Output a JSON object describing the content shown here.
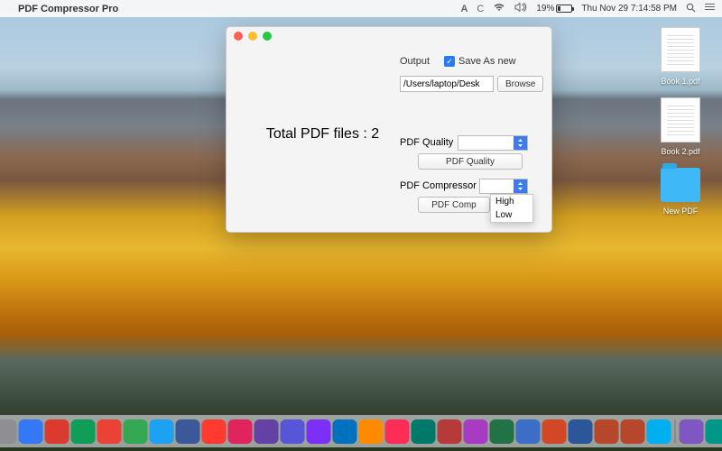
{
  "menubar": {
    "app_name": "PDF Compressor Pro",
    "adobe": "A",
    "battery_pct": "19%",
    "datetime": "Thu Nov 29  7:14:58 PM"
  },
  "desktop": {
    "book1": "Book 1.pdf",
    "book2": "Book 2.pdf",
    "folder": "New PDF"
  },
  "window": {
    "total_label": "Total PDF files : 2",
    "output_label": "Output",
    "save_as_new_label": "Save As new",
    "path_value": "/Users/laptop/Desk",
    "browse_label": "Browse",
    "quality_label": "PDF Quality",
    "quality_button": "PDF Quality",
    "compressor_label": "PDF Compressor",
    "compressor_button": "PDF Comp",
    "dropdown": {
      "opt1": "High",
      "opt2": "Low"
    }
  },
  "dock_colors": [
    "#f0f0f0",
    "#3478f6",
    "#8e8e93",
    "#3478f6",
    "#db3a2e",
    "#0f9d58",
    "#ea4335",
    "#34a853",
    "#1da1f2",
    "#3b5998",
    "#ff3b30",
    "#e0245e",
    "#6441a5",
    "#5856d6",
    "#7b2ff7",
    "#0071bc",
    "#ff8a00",
    "#ff2d55",
    "#00796b",
    "#b73a3a",
    "#a73bc1",
    "#217346",
    "#3d6ec7",
    "#d24726",
    "#2b579a",
    "#b7472a",
    "#b7472a",
    "#00aff0",
    "#7e57c2",
    "#009688",
    "#d32f2f",
    "#444444"
  ]
}
